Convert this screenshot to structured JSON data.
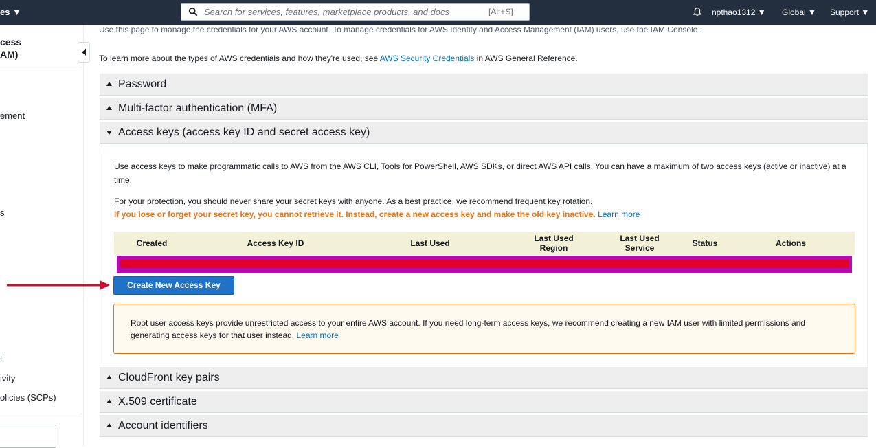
{
  "topnav": {
    "services_label": "es ▼",
    "search_placeholder": "Search for services, features, marketplace products, and docs",
    "search_shortcut": "[Alt+S]",
    "user": "npthao1312 ▼",
    "region": "Global ▼",
    "support": "Support ▼"
  },
  "sidebar": {
    "title_line1": "cess",
    "title_line2": "AM)",
    "items": [
      {
        "label": "ement",
        "link": false
      },
      {
        "label": "s",
        "link": false
      },
      {
        "label": "t",
        "link": true
      },
      {
        "label": "ivity",
        "link": false
      },
      {
        "label": "olicies (SCPs)",
        "link": false
      }
    ]
  },
  "intro": {
    "line1": "Use this page to manage the credentials for your AWS account. To manage credentials for AWS Identity and Access Management (IAM) users, use the IAM Console .",
    "line2_prefix": "To learn more about the types of AWS credentials and how they're used, see ",
    "line2_link": "AWS Security Credentials",
    "line2_suffix": " in AWS General Reference."
  },
  "sections": {
    "password": "Password",
    "mfa": "Multi-factor authentication (MFA)",
    "access_keys": "Access keys (access key ID and secret access key)",
    "cloudfront": "CloudFront key pairs",
    "x509": "X.509 certificate",
    "account_ids": "Account identifiers"
  },
  "access_keys": {
    "desc1": "Use access keys to make programmatic calls to AWS from the AWS CLI, Tools for PowerShell, AWS SDKs, or direct AWS API calls. You can have a maximum of two access keys (active or inactive) at a time.",
    "desc2": "For your protection, you should never share your secret keys with anyone. As a best practice, we recommend frequent key rotation.",
    "warning": "If you lose or forget your secret key, you cannot retrieve it. Instead, create a new access key and make the old key inactive.",
    "learn_more": "Learn more",
    "columns": [
      "Created",
      "Access Key ID",
      "Last Used",
      "Last Used Region",
      "Last Used Service",
      "Status",
      "Actions"
    ],
    "create_button": "Create New Access Key",
    "notice": "Root user access keys provide unrestricted access to your entire AWS account. If you need long-term access keys, we recommend creating a new IAM user with limited permissions and generating access keys for that user instead.",
    "notice_link": "Learn more"
  },
  "colors": {
    "nav_bg": "#232f3e",
    "link": "#0073bb",
    "warning": "#ec7211",
    "button": "#1f72c5",
    "redact_outer": "#b40cae",
    "redact_inner": "#e00029",
    "arrow": "#c8102e"
  }
}
